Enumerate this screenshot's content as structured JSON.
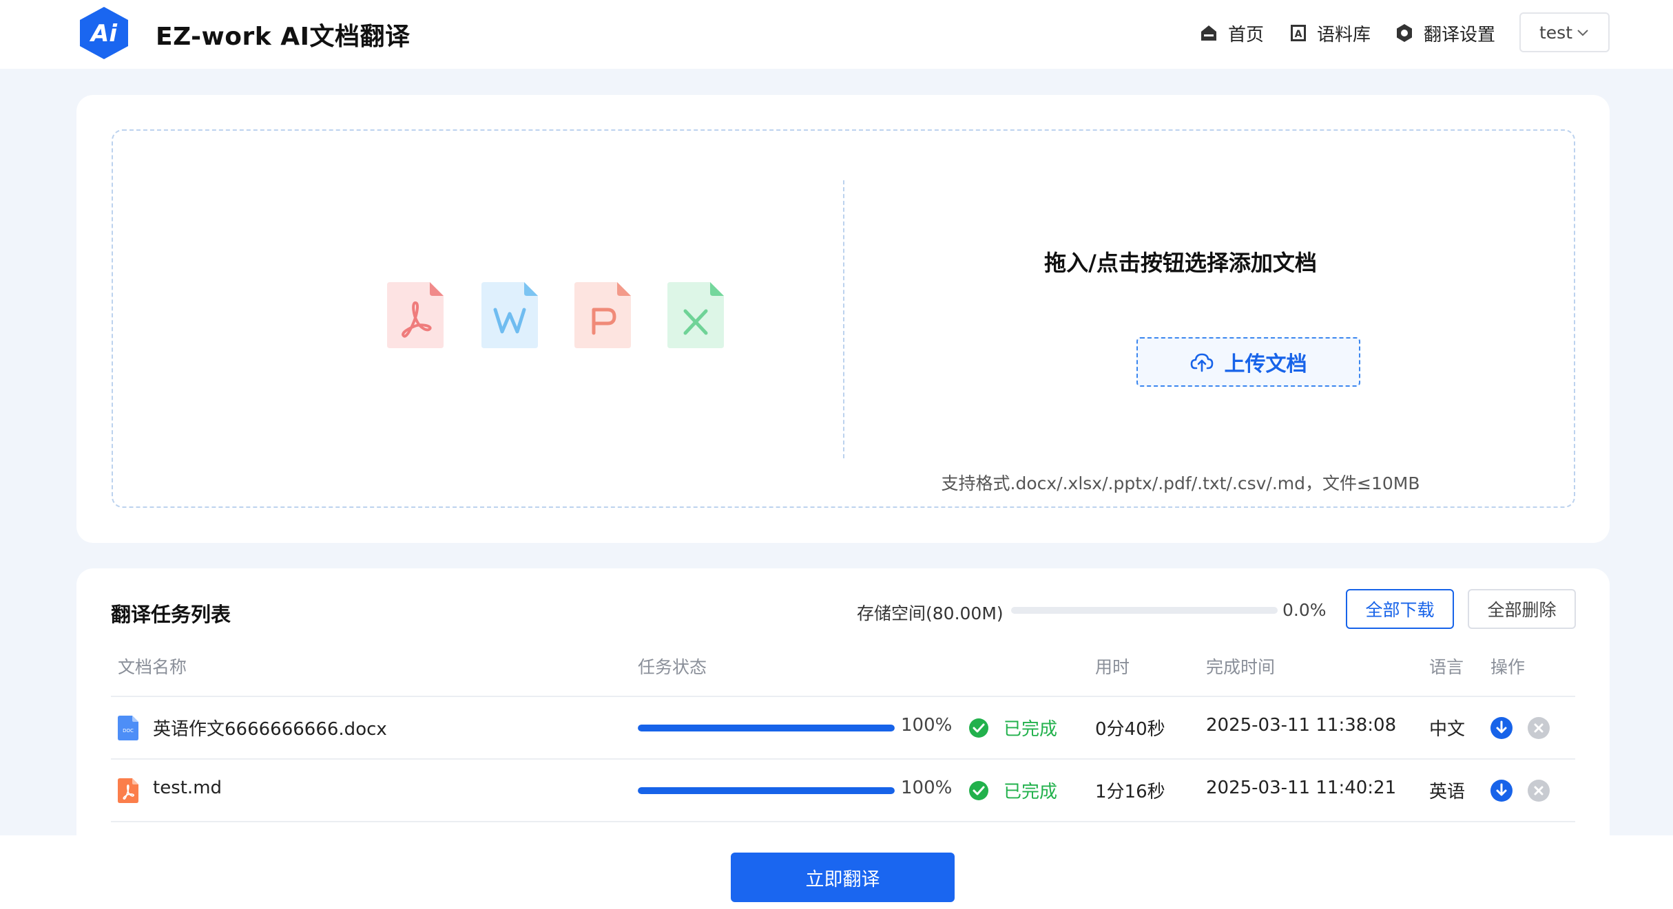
{
  "header": {
    "app_title": "EZ-work AI文档翻译",
    "logo_text": "Ai",
    "nav": [
      {
        "label": "首页",
        "icon": "home-icon"
      },
      {
        "label": "语料库",
        "icon": "corpus-icon"
      },
      {
        "label": "翻译设置",
        "icon": "settings-icon"
      }
    ],
    "user": {
      "name": "test",
      "icon": "chevron-down-icon"
    }
  },
  "upload": {
    "file_types": [
      "pdf",
      "word",
      "powerpoint",
      "excel"
    ],
    "drop_title": "拖入/点击按钮选择添加文档",
    "button_label": "上传文档",
    "button_icon": "cloud-upload-icon",
    "format_hint": "支持格式.docx/.xlsx/.pptx/.pdf/.txt/.csv/.md，文件≤10MB"
  },
  "tasks": {
    "title": "翻译任务列表",
    "storage_label": "存储空间(80.00M)",
    "storage_used_fraction": 0.0,
    "storage_percent": "0.0%",
    "download_all": "全部下载",
    "delete_all": "全部删除",
    "columns": {
      "name": "文档名称",
      "status": "任务状态",
      "duration": "用时",
      "finished_at": "完成时间",
      "language": "语言",
      "actions": "操作"
    },
    "rows": [
      {
        "icon": "doc-file-icon",
        "name": "英语作文6666666666.docx",
        "progress_fraction": 1.0,
        "progress_text": "100%",
        "status": "已完成",
        "duration": "0分40秒",
        "finished_at": "2025-03-11 11:38:08",
        "language": "中文"
      },
      {
        "icon": "pdf-file-icon",
        "name": "test.md",
        "progress_fraction": 1.0,
        "progress_text": "100%",
        "status": "已完成",
        "duration": "1分16秒",
        "finished_at": "2025-03-11 11:40:21",
        "language": "英语"
      }
    ]
  },
  "footer": {
    "translate_button": "立即翻译"
  },
  "colors": {
    "primary": "#1763e9",
    "success": "#22b14c",
    "page_bg": "#f1f5fb"
  }
}
